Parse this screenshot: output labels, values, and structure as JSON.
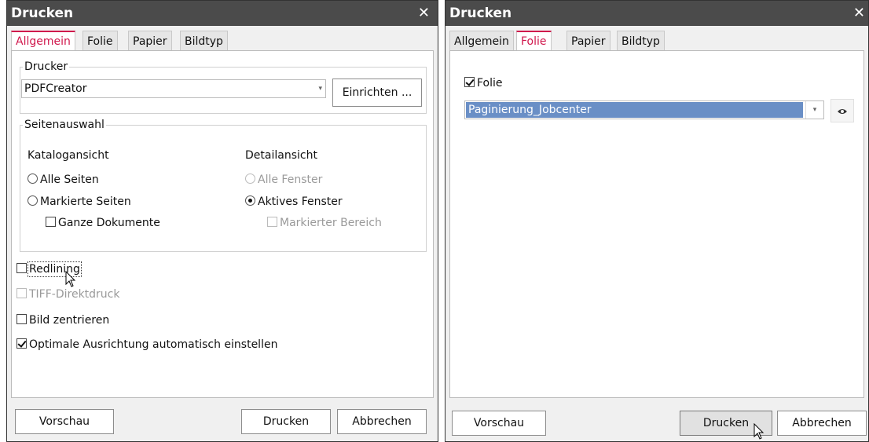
{
  "dialog_left": {
    "title": "Drucken",
    "close_label": "✕",
    "tabs": [
      {
        "label": "Allgemein",
        "active": true
      },
      {
        "label": "Folie",
        "active": false
      },
      {
        "label": "Papier",
        "active": false
      },
      {
        "label": "Bildtyp",
        "active": false
      }
    ],
    "printer_group": {
      "legend": "Drucker",
      "printer_value": "PDFCreator",
      "setup_button": "Einrichten ..."
    },
    "page_selection": {
      "legend": "Seitenauswahl",
      "catalog_heading": "Katalogansicht",
      "all_pages": "Alle Seiten",
      "marked_pages": "Markierte Seiten",
      "whole_documents": "Ganze Dokumente",
      "detail_heading": "Detailansicht",
      "all_windows": "Alle Fenster",
      "active_window": "Aktives Fenster",
      "marked_area": "Markierter Bereich"
    },
    "options": {
      "redlining": "Redlining",
      "tiff_direct": "TIFF-Direktdruck",
      "center_image": "Bild zentrieren",
      "optimal_orientation": "Optimale Ausrichtung automatisch einstellen"
    },
    "buttons": {
      "preview": "Vorschau",
      "print": "Drucken",
      "cancel": "Abbrechen"
    }
  },
  "dialog_right": {
    "title": "Drucken",
    "close_label": "✕",
    "tabs": [
      {
        "label": "Allgemein",
        "active": false
      },
      {
        "label": "Folie",
        "active": true
      },
      {
        "label": "Papier",
        "active": false
      },
      {
        "label": "Bildtyp",
        "active": false
      }
    ],
    "foil_checkbox": "Folie",
    "foil_checked": true,
    "foil_value": "Paginierung_Jobcenter",
    "buttons": {
      "preview": "Vorschau",
      "print": "Drucken",
      "cancel": "Abbrechen"
    }
  },
  "colors": {
    "titlebar": "#4b4b4b",
    "active_tab": "#d0174c",
    "selection": "#6a8fc6"
  },
  "icons": [
    "close-icon",
    "dropdown-arrow-icon",
    "eye-icon",
    "mouse-pointer-icon"
  ]
}
